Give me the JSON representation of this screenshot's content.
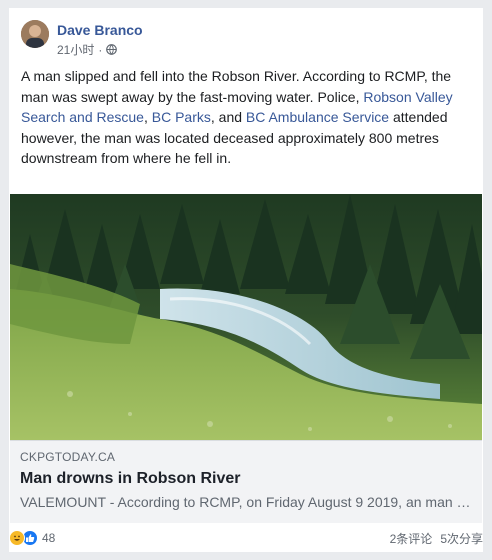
{
  "post": {
    "author": "Dave Branco",
    "time": "21小时",
    "separator": "·",
    "privacy_icon": "globe-icon",
    "text": {
      "part1": "A man slipped and fell into the Robson River. According to RCMP, the man was swept away by the fast-moving water. Police, ",
      "link1": "Robson Valley Search and Rescue",
      "part2": ", ",
      "link2": "BC Parks",
      "part3": ", and ",
      "link3": "BC Ambulance Service",
      "part4": " attended however, the man was located deceased approximately 800 metres downstream from where he fell in."
    }
  },
  "link_preview": {
    "domain": "CKPGTODAY.CA",
    "title": "Man drowns in Robson River",
    "description": "VALEMOUNT - According to RCMP, on Friday August 9 2019, an man slipped and fell into the Robson River..."
  },
  "footer": {
    "reaction_icons": [
      "haha-icon",
      "like-icon"
    ],
    "reaction_count": "48",
    "comments": "2条评论",
    "shares": "5次分享"
  },
  "colors": {
    "link": "#385898",
    "like": "#1877f2",
    "haha": "#f7b928",
    "background": "#e9ebee"
  }
}
